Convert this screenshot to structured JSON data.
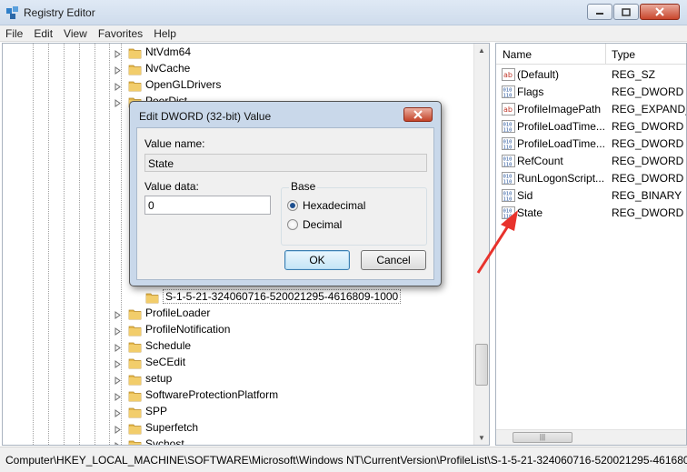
{
  "window": {
    "title": "Registry Editor"
  },
  "menu": [
    "File",
    "Edit",
    "View",
    "Favorites",
    "Help"
  ],
  "tree": {
    "items_top": [
      "NtVdm64",
      "NvCache",
      "OpenGLDrivers",
      "PeerDist"
    ],
    "selected_key": "S-1-5-21-324060716-520021295-4616809-1000",
    "items_bottom": [
      "ProfileLoader",
      "ProfileNotification",
      "Schedule",
      "SeCEdit",
      "setup",
      "SoftwareProtectionPlatform",
      "SPP",
      "Superfetch",
      "Svchost"
    ]
  },
  "values_pane": {
    "col_name": "Name",
    "col_type": "Type",
    "rows": [
      {
        "name": "(Default)",
        "type": "REG_SZ",
        "icon": "string-value-icon"
      },
      {
        "name": "Flags",
        "type": "REG_DWORD",
        "icon": "binary-value-icon"
      },
      {
        "name": "ProfileImagePath",
        "type": "REG_EXPAND_SZ",
        "icon": "string-value-icon"
      },
      {
        "name": "ProfileLoadTime...",
        "type": "REG_DWORD",
        "icon": "binary-value-icon"
      },
      {
        "name": "ProfileLoadTime...",
        "type": "REG_DWORD",
        "icon": "binary-value-icon"
      },
      {
        "name": "RefCount",
        "type": "REG_DWORD",
        "icon": "binary-value-icon"
      },
      {
        "name": "RunLogonScript...",
        "type": "REG_DWORD",
        "icon": "binary-value-icon"
      },
      {
        "name": "Sid",
        "type": "REG_BINARY",
        "icon": "binary-value-icon"
      },
      {
        "name": "State",
        "type": "REG_DWORD",
        "icon": "binary-value-icon"
      }
    ]
  },
  "statusbar": {
    "path": "Computer\\HKEY_LOCAL_MACHINE\\SOFTWARE\\Microsoft\\Windows NT\\CurrentVersion\\ProfileList\\S-1-5-21-324060716-520021295-461680"
  },
  "dialog": {
    "title": "Edit DWORD (32-bit) Value",
    "value_name_label": "Value name:",
    "value_name": "State",
    "value_data_label": "Value data:",
    "value_data": "0",
    "base_label": "Base",
    "base_options": [
      "Hexadecimal",
      "Decimal"
    ],
    "base_selected": "Hexadecimal",
    "ok_label": "OK",
    "cancel_label": "Cancel"
  },
  "colors": {
    "annotation_arrow": "#e8322c",
    "folder": "#e6b84a",
    "dialog_frame": "#c9d8ea"
  }
}
